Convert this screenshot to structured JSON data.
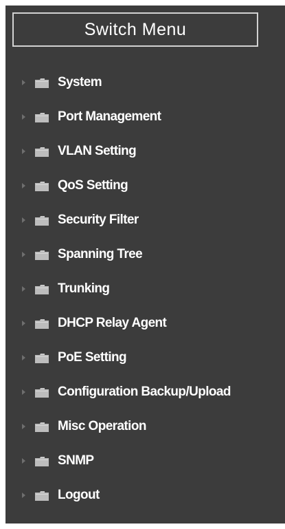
{
  "menu": {
    "title": "Switch Menu",
    "items": [
      {
        "label": "System"
      },
      {
        "label": "Port Management"
      },
      {
        "label": "VLAN Setting"
      },
      {
        "label": "QoS Setting"
      },
      {
        "label": "Security Filter"
      },
      {
        "label": "Spanning Tree"
      },
      {
        "label": "Trunking"
      },
      {
        "label": "DHCP Relay Agent"
      },
      {
        "label": "PoE Setting"
      },
      {
        "label": "Configuration Backup/Upload"
      },
      {
        "label": "Misc Operation"
      },
      {
        "label": "SNMP"
      },
      {
        "label": "Logout"
      }
    ]
  },
  "icons": {
    "expander": "expand-arrow-icon",
    "item": "folder-icon"
  },
  "colors": {
    "panel_background": "#3c3c3c",
    "text": "#ffffff",
    "title_border": "#d2d2d2",
    "folder_icon": "#c8c8c8"
  }
}
